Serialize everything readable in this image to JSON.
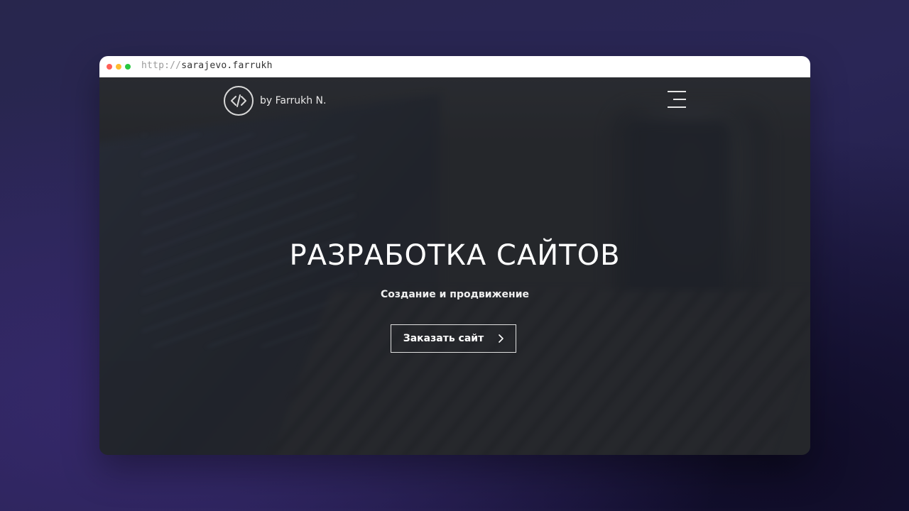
{
  "browser": {
    "url_protocol": "http://",
    "url_host": "sarajevo.farrukh"
  },
  "header": {
    "logo_icon": "code-icon",
    "logo_text": "by Farrukh N.",
    "menu_icon": "hamburger-menu-icon"
  },
  "hero": {
    "title": "РАЗРАБОТКА САЙТОВ",
    "subtitle": "Создание и продвижение",
    "cta_label": "Заказать сайт",
    "cta_icon": "chevron-right-icon"
  },
  "colors": {
    "window_dots": [
      "#ff5f57",
      "#febc2e",
      "#28c840"
    ],
    "hero_text": "#ffffff"
  }
}
